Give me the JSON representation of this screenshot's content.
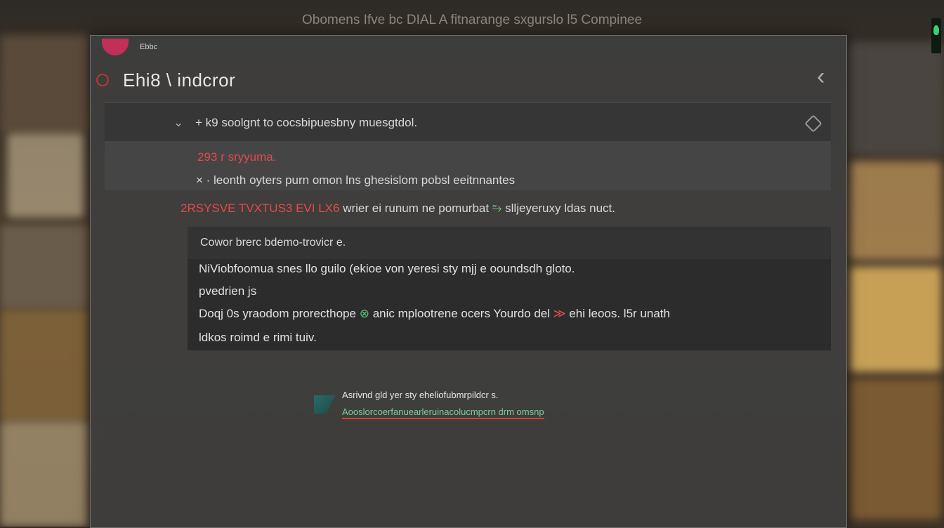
{
  "window": {
    "title": "Obomens  Ifve bc  DIAL  A fitnarange  sxgurslo  l5  Compinee"
  },
  "dialog": {
    "small_label": "Ebbc",
    "title": "Ehi8  \\ indcror",
    "close_icon": "chevron-left-icon"
  },
  "panel": {
    "row1_caret": "⌄",
    "row1_text": "+ k9  soolgnt  to  cocsbipuesbny  muesgtdol.",
    "row2_text": "293 r sryyuma.",
    "row3_text": "× ·  leonth oyters  purn  omon  lns  ghesislom  pobsl eeitnnantes",
    "row4_prefix": "2RSYSVE  TVXTUS3  EVI  LX6",
    "row4_text": "wrier  ei  runum  ne  pomurbat",
    "row4_arrow": "⥲",
    "row4_suffix": "slljeyeruxy  ldas  nuct."
  },
  "content": {
    "heading": "Cowor  brerc   bdemo-trovicr  e.",
    "line1": "NiViobfoomua  snes  llo  guilo  (ekioe von  yeresi  sty  mjj  e  ooundsdh  gloto.",
    "line2": "pvedrien  js",
    "line3_a": "Doqj  0s  yraodom  prorecthope",
    "line3_icon": "⊗",
    "line3_b": "anic mplootrene  ocers Yourdo  del",
    "line3_arrow": "≫",
    "line3_c": "ehi  leoos.  l5r    unath",
    "line4": "ldkos  roimd  e  rimi  tuiv."
  },
  "status": {
    "line1": "Asrivnd gld yer sty  eheliofubmrpildcr  s.",
    "link": "Aooslorcoerfanuearleruinacolucmpcrn  drm omsnp"
  }
}
